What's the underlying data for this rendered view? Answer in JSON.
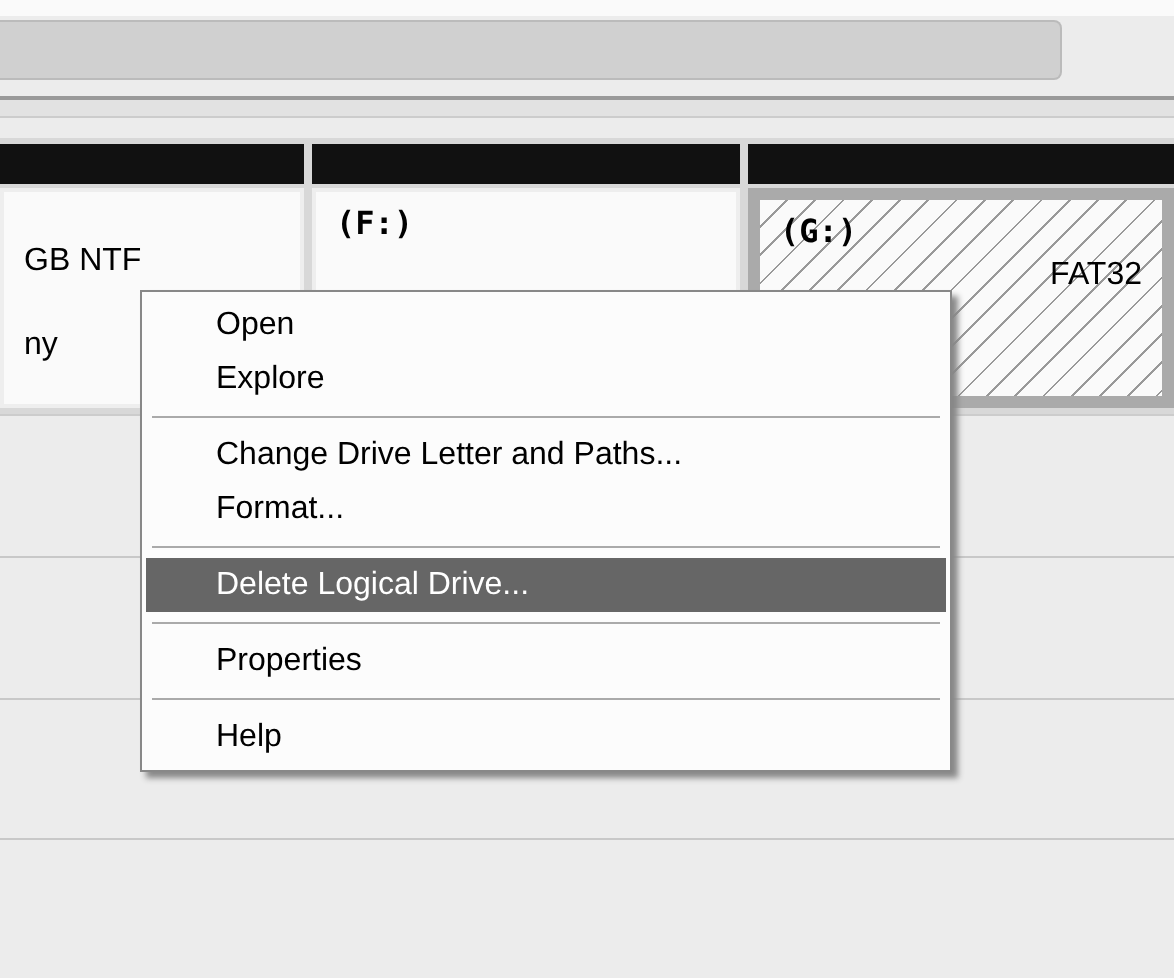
{
  "partitions": [
    {
      "lines": [
        "GB NTF",
        "ny"
      ],
      "selected": false
    },
    {
      "letter": "(F:)",
      "selected": false
    },
    {
      "letter": "(G:)",
      "lines": [
        "FAT32"
      ],
      "selected": true
    }
  ],
  "context_menu": [
    {
      "kind": "item",
      "label": "Open",
      "selected": false
    },
    {
      "kind": "item",
      "label": "Explore",
      "selected": false
    },
    {
      "kind": "separator"
    },
    {
      "kind": "item",
      "label": "Change Drive Letter and Paths...",
      "selected": false
    },
    {
      "kind": "item",
      "label": "Format...",
      "selected": false
    },
    {
      "kind": "separator"
    },
    {
      "kind": "item",
      "label": "Delete Logical Drive...",
      "selected": true
    },
    {
      "kind": "separator"
    },
    {
      "kind": "item",
      "label": "Properties",
      "selected": false
    },
    {
      "kind": "separator"
    },
    {
      "kind": "item",
      "label": "Help",
      "selected": false
    }
  ]
}
